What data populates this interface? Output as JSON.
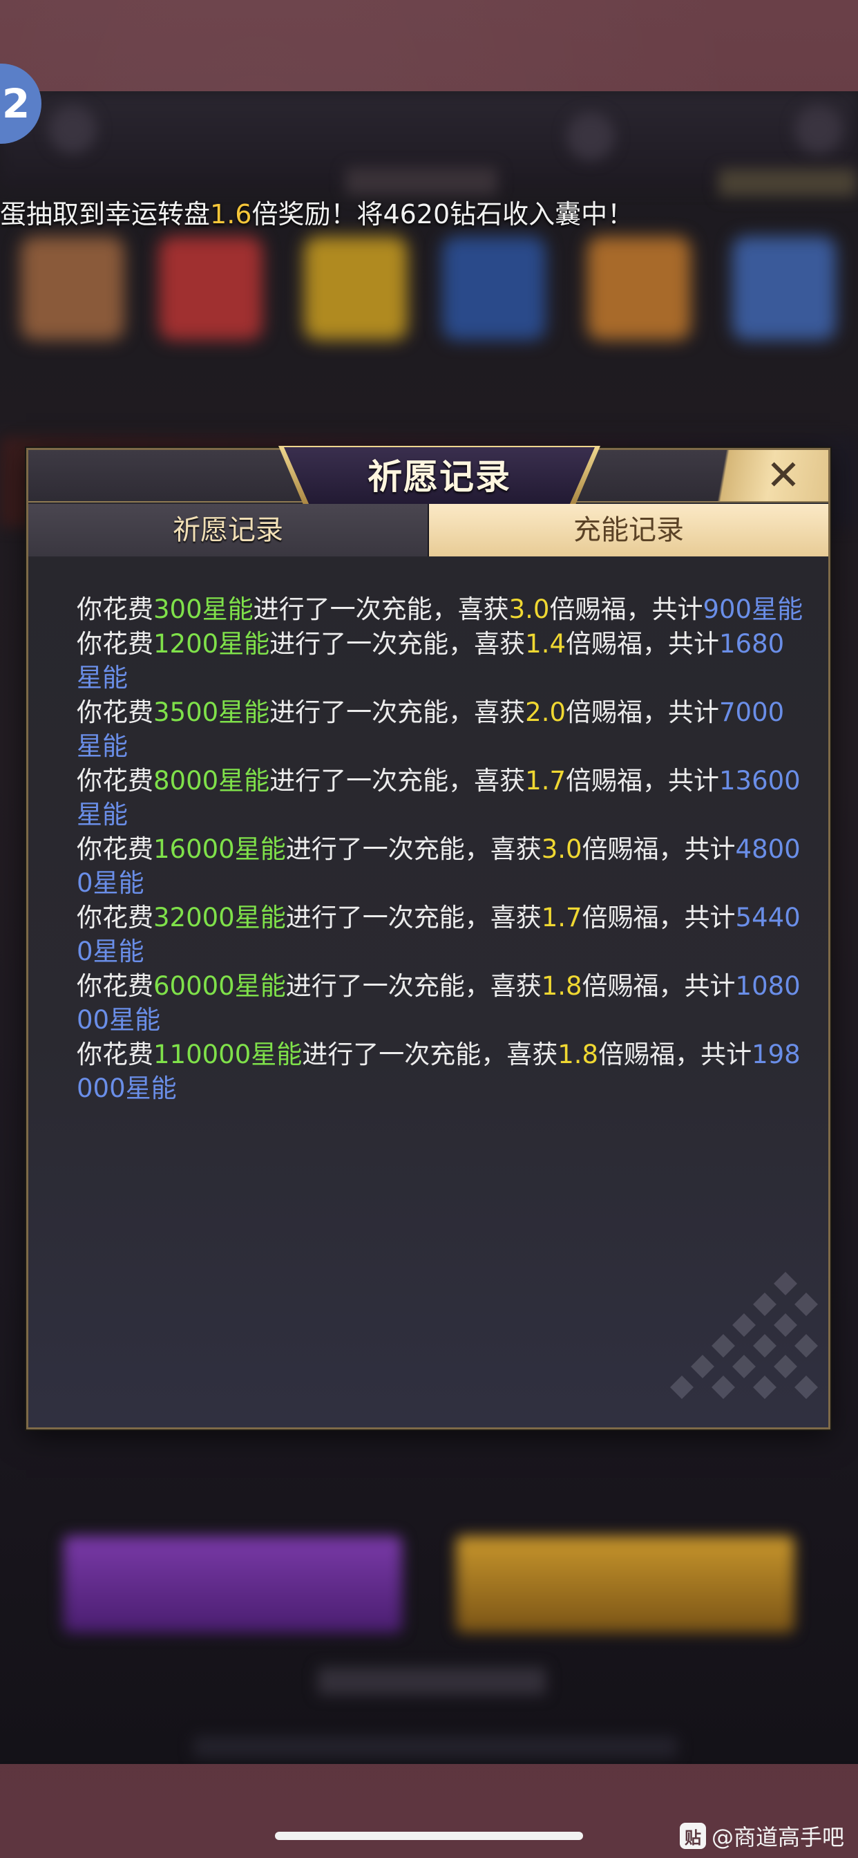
{
  "ticker": {
    "pre": "蛋抽取到幸运转盘",
    "multiplier": "1.6",
    "post": "倍奖励！将4620钻石收入囊中！"
  },
  "badge": {
    "glyph": "2"
  },
  "modal": {
    "title": "祈愿记录",
    "close_icon": "close-icon",
    "tabs": [
      {
        "label": "祈愿记录",
        "active": false
      },
      {
        "label": "充能记录",
        "active": true
      }
    ],
    "records": [
      {
        "p1": "你花费",
        "cost": "300星能",
        "p2": "进行了一次充能，喜获",
        "mult": "3.0",
        "p3": "倍赐福，共计",
        "total": "900星能"
      },
      {
        "p1": "你花费",
        "cost": "1200星能",
        "p2": "进行了一次充能，喜获",
        "mult": "1.4",
        "p3": "倍赐福，共计",
        "total": "1680星能"
      },
      {
        "p1": "你花费",
        "cost": "3500星能",
        "p2": "进行了一次充能，喜获",
        "mult": "2.0",
        "p3": "倍赐福，共计",
        "total": "7000星能"
      },
      {
        "p1": "你花费",
        "cost": "8000星能",
        "p2": "进行了一次充能，喜获",
        "mult": "1.7",
        "p3": "倍赐福，共计",
        "total": "13600星能"
      },
      {
        "p1": "你花费",
        "cost": "16000星能",
        "p2": "进行了一次充能，喜获",
        "mult": "3.0",
        "p3": "倍赐福，共计",
        "total": "48000星能"
      },
      {
        "p1": "你花费",
        "cost": "32000星能",
        "p2": "进行了一次充能，喜获",
        "mult": "1.7",
        "p3": "倍赐福，共计",
        "total": "54400星能"
      },
      {
        "p1": "你花费",
        "cost": "60000星能",
        "p2": "进行了一次充能，喜获",
        "mult": "1.8",
        "p3": "倍赐福，共计",
        "total": "108000星能"
      },
      {
        "p1": "你花费",
        "cost": "110000星能",
        "p2": "进行了一次充能，喜获",
        "mult": "1.8",
        "p3": "倍赐福，共计",
        "total": "198000星能"
      }
    ]
  },
  "watermark": {
    "icon_glyph": "贴",
    "text": "@商道高手吧"
  },
  "colors": {
    "cost": "#7fe14a",
    "multiplier": "#f0d832",
    "total": "#6a8ee8",
    "ticker_highlight": "#f6c63a"
  }
}
